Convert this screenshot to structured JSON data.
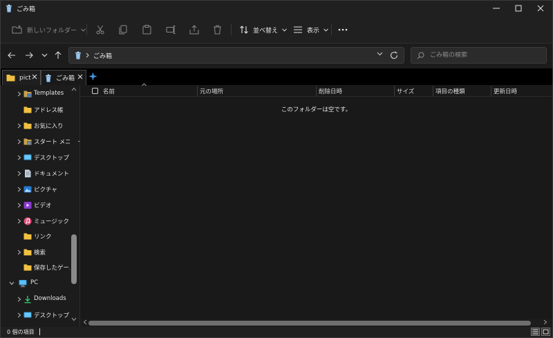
{
  "window": {
    "title": "ごみ箱"
  },
  "command_bar": {
    "new_folder_label": "新しいフォルダー",
    "sort_label": "並べ替え",
    "view_label": "表示"
  },
  "address": {
    "crumb": "ごみ箱",
    "search_placeholder": "ごみ箱の検索"
  },
  "tabs": [
    {
      "label": "pict"
    },
    {
      "label": "ごみ箱"
    }
  ],
  "nav_items": [
    {
      "label": "Templates",
      "icon": "templates-folder-icon"
    },
    {
      "label": "アドレス帳",
      "icon": "folder-icon"
    },
    {
      "label": "お気に入り",
      "icon": "folder-icon"
    },
    {
      "label": "スタート メニュー",
      "icon": "start-menu-folder-icon"
    },
    {
      "label": "デスクトップ",
      "icon": "desktop-folder-icon"
    },
    {
      "label": "ドキュメント",
      "icon": "documents-folder-icon"
    },
    {
      "label": "ピクチャ",
      "icon": "pictures-folder-icon"
    },
    {
      "label": "ビデオ",
      "icon": "videos-folder-icon"
    },
    {
      "label": "ミュージック",
      "icon": "music-folder-icon"
    },
    {
      "label": "リンク",
      "icon": "folder-icon"
    },
    {
      "label": "検索",
      "icon": "folder-icon"
    },
    {
      "label": "保存したゲーム",
      "icon": "folder-icon"
    },
    {
      "label": "PC",
      "icon": "pc-icon"
    },
    {
      "label": "Downloads",
      "icon": "downloads-icon"
    },
    {
      "label": "デスクトップ",
      "icon": "desktop-folder-icon"
    }
  ],
  "columns": [
    {
      "label": "名前"
    },
    {
      "label": "元の場所"
    },
    {
      "label": "削除日時"
    },
    {
      "label": "サイズ"
    },
    {
      "label": "項目の種類"
    },
    {
      "label": "更新日時"
    }
  ],
  "empty_message": "このフォルダーは空です。",
  "status": {
    "item_count": "0 個の項目"
  },
  "colors": {
    "accent": "#4aa0f0",
    "folder": "#f0c040",
    "background": "#191919"
  }
}
